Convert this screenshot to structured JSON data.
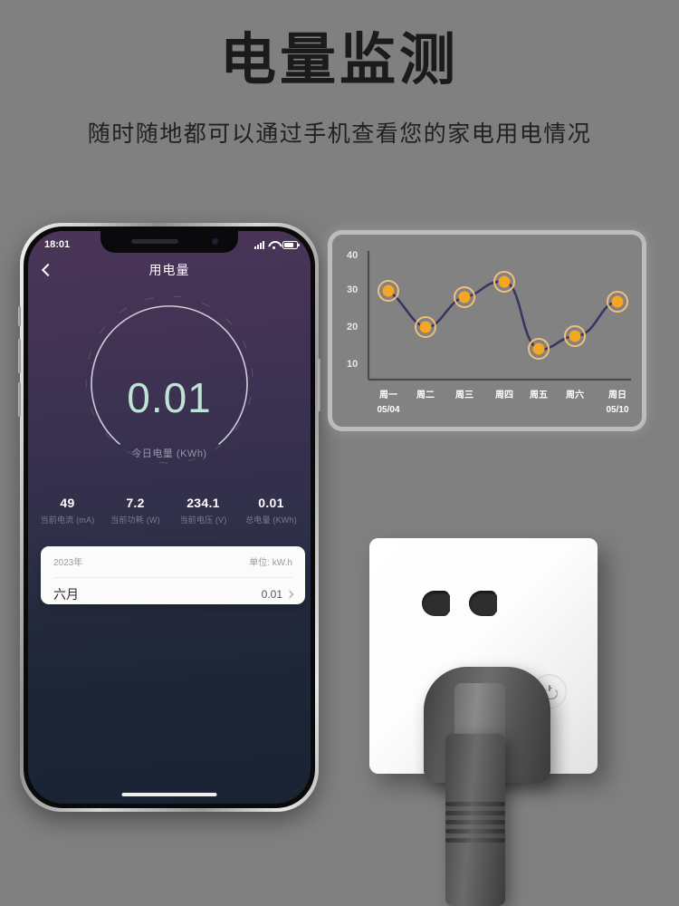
{
  "hero": {
    "title": "电量监测",
    "subtitle": "随时随地都可以通过手机查看您的家电用电情况"
  },
  "phone": {
    "status_bar": {
      "time": "18:01",
      "signal_icon": "signal-bars-icon",
      "wifi_icon": "wifi-icon",
      "battery_icon": "battery-icon"
    },
    "nav": {
      "back_icon": "back-chevron-icon",
      "title": "用电量"
    },
    "gauge": {
      "value": "0.01",
      "label": "今日电量 (KWh)"
    },
    "stats": [
      {
        "value": "49",
        "label": "当前电流 (mA)"
      },
      {
        "value": "7.2",
        "label": "当前功耗 (W)"
      },
      {
        "value": "234.1",
        "label": "当前电压 (V)"
      },
      {
        "value": "0.01",
        "label": "总电量 (KWh)"
      }
    ],
    "card": {
      "year": "2023年",
      "unit": "单位: kW.h",
      "month": "六月",
      "month_value": "0.01",
      "chevron_icon": "chevron-right-icon"
    }
  },
  "socket": {
    "power_button_icon": "power-icon",
    "slot_left_icon": "socket-slot-icon",
    "slot_right_icon": "socket-slot-icon",
    "plug_label": "plug-icon"
  },
  "colors": {
    "page_background": "#808080",
    "accent_marker": "#f5a623",
    "marker_ring": "#f0c07a",
    "line": "#3b3560",
    "gauge_value": "#bfe3d6",
    "screen_top": "#4a3557",
    "screen_bottom": "#192433"
  },
  "chart_data": {
    "type": "line",
    "title": "",
    "xlabel": "",
    "ylabel": "",
    "categories": [
      "周一",
      "周二",
      "周三",
      "周四",
      "周五",
      "周六",
      "周日"
    ],
    "sub_labels": [
      "05/04",
      "",
      "",
      "",
      "",
      "",
      "05/10"
    ],
    "values": [
      31,
      22.5,
      30,
      33.5,
      16,
      18,
      28.5
    ],
    "yticks": [
      40,
      30,
      20,
      10
    ],
    "ylim": [
      5,
      43
    ],
    "grid": false,
    "legend": "none",
    "marker": "circle",
    "smooth": true
  }
}
